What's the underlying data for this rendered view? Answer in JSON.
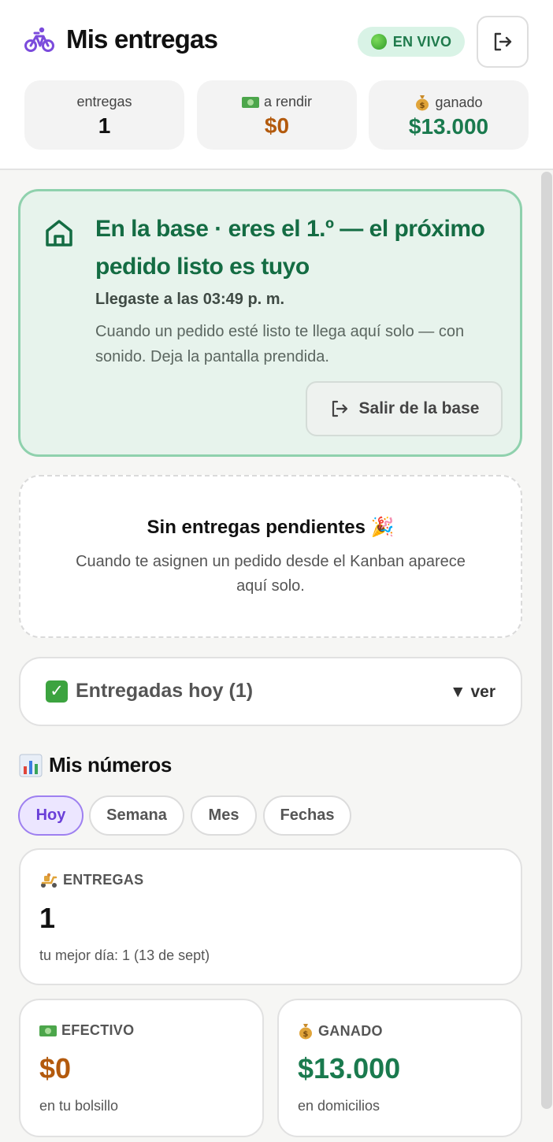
{
  "header": {
    "title": "Mis entregas",
    "live_badge": "EN VIVO",
    "stats": [
      {
        "label": "entregas",
        "value": "1"
      },
      {
        "label": "a rendir",
        "value": "$0"
      },
      {
        "label": "ganado",
        "value": "$13.000"
      }
    ]
  },
  "base_card": {
    "title": "En la base · eres el 1.º — el próximo pedido listo es tuyo",
    "arrival": "Llegaste a las 03:49 p. m.",
    "description": "Cuando un pedido esté listo te llega aquí solo — con sonido. Deja la pantalla prendida.",
    "leave_button": "Salir de la base"
  },
  "empty_state": {
    "title": "Sin entregas pendientes 🎉",
    "description": "Cuando te asignen un pedido desde el Kanban aparece aquí solo."
  },
  "delivered_today": {
    "label": "Entregadas hoy (1)",
    "toggle": "▼ ver"
  },
  "numbers": {
    "title": "Mis números",
    "tabs": [
      "Hoy",
      "Semana",
      "Mes",
      "Fechas"
    ],
    "active_tab": "Hoy",
    "cards": [
      {
        "label": "ENTREGAS",
        "value": "1",
        "note": "tu mejor día: 1 (13 de sept)"
      },
      {
        "label": "EFECTIVO",
        "value": "$0",
        "note": "en tu bolsillo"
      },
      {
        "label": "GANADO",
        "value": "$13.000",
        "note": "en domicilios"
      }
    ]
  },
  "colors": {
    "accent_purple": "#7b4bdc",
    "green_text": "#146c43",
    "amber_text": "#b35a0d",
    "base_card_bg": "#e7f3ec",
    "base_card_border": "#8fd1ad"
  },
  "icons": {
    "brand": "bicycle-icon",
    "logout": "logout-icon",
    "base": "home-icon",
    "leave": "logout-icon",
    "stat_cash": "cash-icon",
    "stat_earned": "money-bag-icon"
  }
}
